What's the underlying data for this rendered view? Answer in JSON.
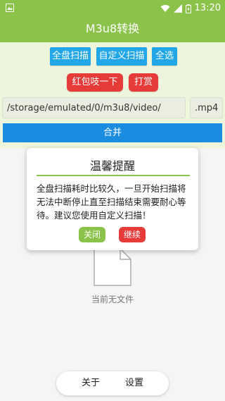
{
  "status_bar": {
    "time": "13:20",
    "icons": [
      "image-icon",
      "wifi-icon",
      "cellular-signal-icon",
      "battery-charging-icon"
    ]
  },
  "app_bar": {
    "title": "M3u8转换"
  },
  "toolbar": {
    "full_scan": "全盘扫描",
    "custom_scan": "自定义扫描",
    "select_all": "全选",
    "red_packet": "红包吱一下",
    "tip": "打赏"
  },
  "path_field": {
    "value": "/storage/emulated/0/m3u8/video/"
  },
  "ext_field": {
    "value": ".mp4"
  },
  "merge_button": {
    "label": "合并"
  },
  "empty_state": {
    "icon": "file-icon",
    "text": "当前无文件"
  },
  "dialog": {
    "title": "温馨提醒",
    "message": "全盘扫描耗时比较久，一旦开始扫描将无法中断停止直至扫描结束需要耐心等待。建议您使用自定义扫描！",
    "close": "关闭",
    "continue": "继续"
  },
  "bottom_nav": {
    "about": "关于",
    "settings": "设置"
  },
  "colors": {
    "primary_green": "#8bc34a",
    "button_blue": "#21a6e7",
    "merge_blue": "#1a8de0",
    "button_red": "#e73b3a"
  }
}
